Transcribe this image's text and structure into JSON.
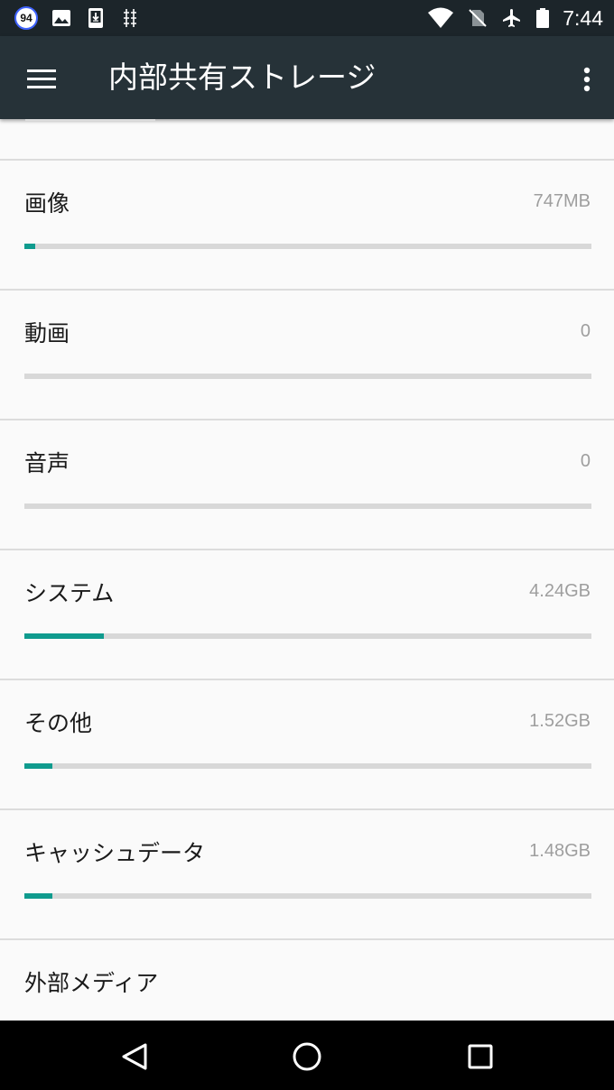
{
  "status_bar": {
    "notification_badge": "94",
    "time": "7:44",
    "icons": [
      "badge-94-icon",
      "image-icon",
      "download-icon",
      "usb-debug-icon",
      "wifi-icon",
      "no-sim-icon",
      "airplane-icon",
      "battery-icon"
    ]
  },
  "app_bar": {
    "title": "内部共有ストレージ",
    "background": "#263238"
  },
  "storage": {
    "accent_color": "#0f9b8e",
    "items": [
      {
        "label": "画像",
        "size": "747MB",
        "fraction": 0.019
      },
      {
        "label": "動画",
        "size": "0",
        "fraction": 0
      },
      {
        "label": "音声",
        "size": "0",
        "fraction": 0
      },
      {
        "label": "システム",
        "size": "4.24GB",
        "fraction": 0.14
      },
      {
        "label": "その他",
        "size": "1.52GB",
        "fraction": 0.05
      },
      {
        "label": "キャッシュデータ",
        "size": "1.48GB",
        "fraction": 0.05
      }
    ],
    "external": {
      "label": "外部メディア"
    }
  },
  "nav_bar": {
    "icons": [
      "back-icon",
      "home-icon",
      "recents-icon"
    ]
  }
}
